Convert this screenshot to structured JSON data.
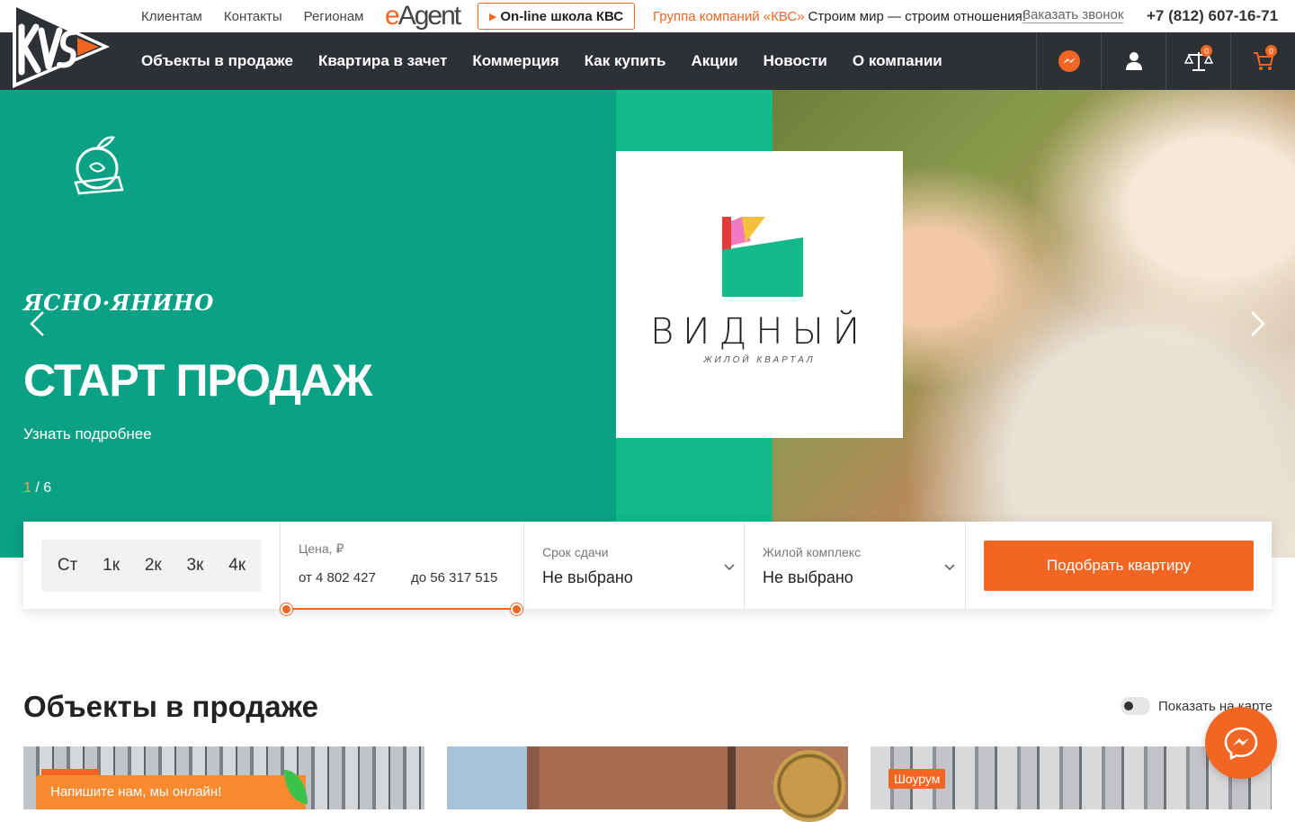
{
  "topbar": {
    "links": [
      "Клиентам",
      "Контакты",
      "Регионам"
    ],
    "eagent_e": "e",
    "eagent_rest": "Agent",
    "school_label": "On-line школа КВС",
    "slogan_brand": "Группа компаний «КВС»",
    "slogan_text": "Строим мир — строим отношения!",
    "callback_label": "Заказать звонок",
    "phone": "+7 (812) 607-16-71"
  },
  "nav": {
    "items": [
      "Объекты в продаже",
      "Квартира в зачет",
      "Коммерция",
      "Как купить",
      "Акции",
      "Новости",
      "О компании"
    ],
    "compare_count": "0",
    "cart_count": "0"
  },
  "hero": {
    "left_logo_text": "ЯСНО·ЯНИНО",
    "card_title": "ВИДНЫЙ",
    "card_subtitle": "ЖИЛОЙ КВАРТАЛ",
    "title": "СТАРТ ПРОДАЖ",
    "more_label": "Узнать подробнее",
    "pager_current": "1",
    "pager_sep": " / ",
    "pager_total": "6"
  },
  "filter": {
    "rooms": [
      "Ст",
      "1к",
      "2к",
      "3к",
      "4к"
    ],
    "price_label": "Цена, ₽",
    "price_from": "от 4 802 427",
    "price_to": "до 56 317 515",
    "deadline_label": "Срок сдачи",
    "deadline_value": "Не выбрано",
    "complex_label": "Жилой комплекс",
    "complex_value": "Не выбрано",
    "submit_label": "Подобрать квартиру"
  },
  "objects": {
    "title": "Объекты в продаже",
    "map_toggle_label": "Показать на карте",
    "card3_badge": "Шоурум"
  },
  "chat": {
    "prompt": "Напишите нам, мы онлайн!"
  },
  "colors": {
    "accent": "#f26522",
    "nav_bg": "#2d3136",
    "hero_bg": "#0aa184"
  }
}
